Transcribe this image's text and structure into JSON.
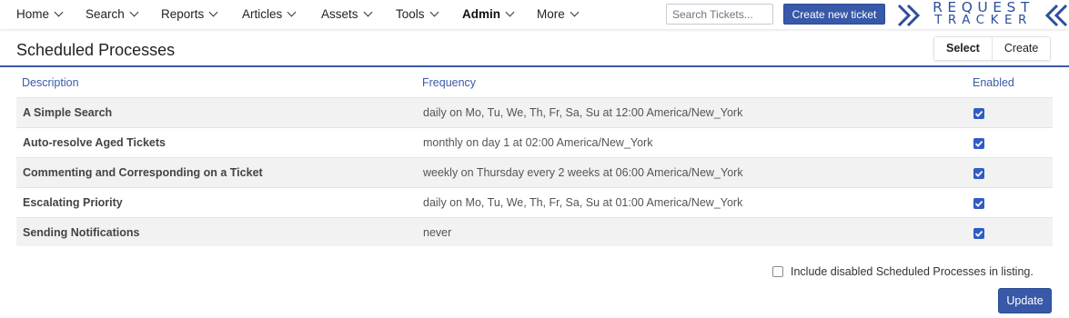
{
  "nav": {
    "items": [
      {
        "label": "Home"
      },
      {
        "label": "Search"
      },
      {
        "label": "Reports"
      },
      {
        "label": "Articles"
      },
      {
        "label": "Assets"
      },
      {
        "label": "Tools"
      },
      {
        "label": "Admin",
        "active": true
      },
      {
        "label": "More"
      }
    ],
    "search_placeholder": "Search Tickets...",
    "create_ticket_label": "Create new ticket"
  },
  "logo": {
    "line1": "REQUEST",
    "line2": "TRACKER"
  },
  "page": {
    "title": "Scheduled Processes",
    "tabs": [
      {
        "label": "Select",
        "active": true
      },
      {
        "label": "Create"
      }
    ]
  },
  "table": {
    "headers": {
      "description": "Description",
      "frequency": "Frequency",
      "enabled": "Enabled"
    },
    "rows": [
      {
        "description": "A Simple Search",
        "frequency": "daily on Mo, Tu, We, Th, Fr, Sa, Su at 12:00 America/New_York",
        "enabled": true
      },
      {
        "description": "Auto-resolve Aged Tickets",
        "frequency": "monthly on day 1 at 02:00 America/New_York",
        "enabled": true
      },
      {
        "description": "Commenting and Corresponding on a Ticket",
        "frequency": "weekly on Thursday every 2 weeks at 06:00 America/New_York",
        "enabled": true
      },
      {
        "description": "Escalating Priority",
        "frequency": "daily on Mo, Tu, We, Th, Fr, Sa, Su at 01:00 America/New_York",
        "enabled": true
      },
      {
        "description": "Sending Notifications",
        "frequency": "never",
        "enabled": true
      }
    ]
  },
  "footer": {
    "include_disabled_label": "Include disabled Scheduled Processes in listing.",
    "include_disabled_checked": false,
    "update_label": "Update"
  },
  "colors": {
    "accent": "#3858a8",
    "header_text": "#3c5aa6",
    "checkbox": "#2f5cc4"
  }
}
